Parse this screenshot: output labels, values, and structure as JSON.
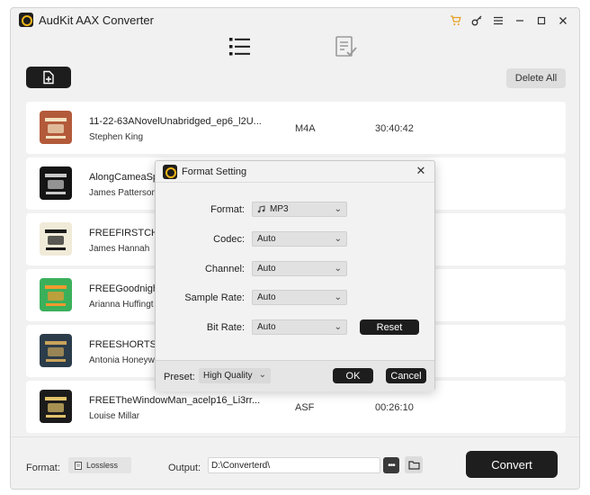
{
  "window": {
    "title": "AudKit AAX Converter"
  },
  "toolbar": {
    "delete_all": "Delete All"
  },
  "files": [
    {
      "title": "11-22-63ANovelUnabridged_ep6_l2U...",
      "author": "Stephen King",
      "format": "M4A",
      "duration": "30:40:42",
      "cover_bg": "#b35a3a",
      "cover_fg": "#f3e2c0"
    },
    {
      "title": "AlongCameaSpi",
      "author": "James Patterson",
      "format": "",
      "duration": "",
      "cover_bg": "#141414",
      "cover_fg": "#c9c9c9"
    },
    {
      "title": "FREEFIRSTCHAI",
      "author": "James Hannah",
      "format": "",
      "duration": "",
      "cover_bg": "#f0ead8",
      "cover_fg": "#1a1a1a"
    },
    {
      "title": "FREEGoodnightS",
      "author": "Arianna Huffingt",
      "format": "",
      "duration": "",
      "cover_bg": "#3bb05b",
      "cover_fg": "#f29a2e"
    },
    {
      "title": "FREESHORTSTC",
      "author": "Antonia Honeyw",
      "format": "",
      "duration": "",
      "cover_bg": "#2b3c4a",
      "cover_fg": "#c8a25a"
    },
    {
      "title": "FREETheWindowMan_acelp16_Li3rr...",
      "author": "Louise Millar",
      "format": "ASF",
      "duration": "00:26:10",
      "cover_bg": "#1b1b1b",
      "cover_fg": "#e2c36a"
    }
  ],
  "bottom": {
    "format_label": "Format:",
    "format_value": "Lossless",
    "output_label": "Output:",
    "output_value": "D:\\Converterd\\",
    "more_label": "•••",
    "convert_label": "Convert"
  },
  "dialog": {
    "title": "Format Setting",
    "fields": [
      {
        "label": "Format:",
        "value": "MP3"
      },
      {
        "label": "Codec:",
        "value": "Auto"
      },
      {
        "label": "Channel:",
        "value": "Auto"
      },
      {
        "label": "Sample Rate:",
        "value": "Auto"
      },
      {
        "label": "Bit Rate:",
        "value": "Auto"
      }
    ],
    "reset_label": "Reset",
    "preset_label": "Preset:",
    "preset_value": "High Quality",
    "ok_label": "OK",
    "cancel_label": "Cancel"
  }
}
